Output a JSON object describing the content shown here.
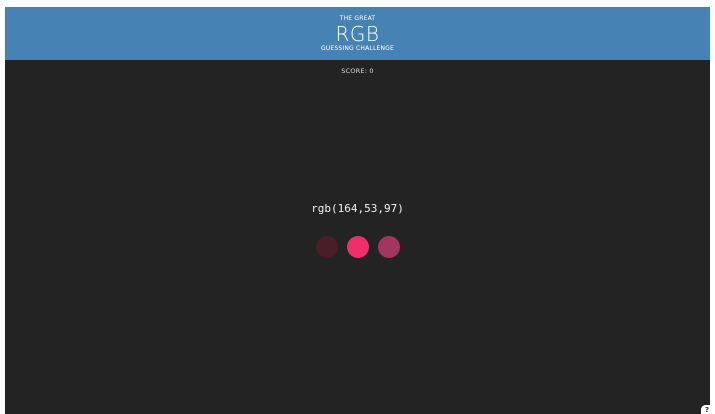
{
  "header": {
    "line1": "THE GREAT",
    "line2": "RGB",
    "line3": "GUESSING CHALLENGE"
  },
  "score": {
    "label": "SCORE: 0"
  },
  "target_color": {
    "text": "rgb(164,53,97)"
  },
  "options": [
    {
      "color": "#4a1e27",
      "name": "color-option-1"
    },
    {
      "color": "#ef2f6c",
      "name": "color-option-2"
    },
    {
      "color": "#a43561",
      "name": "color-option-3"
    }
  ],
  "help": {
    "label": "?"
  }
}
